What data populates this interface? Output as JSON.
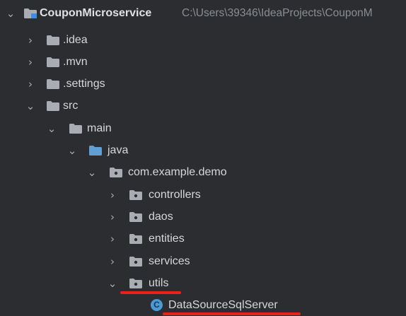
{
  "tree": {
    "root": {
      "name": "CouponMicroservice",
      "path": "C:\\Users\\39346\\IdeaProjects\\CouponM",
      "chevron": "chevron-down-icon",
      "icon": "module-folder-icon"
    },
    "items": [
      {
        "label": ".idea",
        "chevron": "chevron-right-icon",
        "icon": "folder-icon"
      },
      {
        "label": ".mvn",
        "chevron": "chevron-right-icon",
        "icon": "folder-icon"
      },
      {
        "label": ".settings",
        "chevron": "chevron-right-icon",
        "icon": "folder-icon"
      },
      {
        "label": "src",
        "chevron": "chevron-down-icon",
        "icon": "folder-icon"
      },
      {
        "label": "main",
        "chevron": "chevron-down-icon",
        "icon": "folder-icon"
      },
      {
        "label": "java",
        "chevron": "chevron-down-icon",
        "icon": "source-folder-icon"
      },
      {
        "label": "com.example.demo",
        "chevron": "chevron-down-icon",
        "icon": "package-icon"
      },
      {
        "label": "controllers",
        "chevron": "chevron-right-icon",
        "icon": "package-icon"
      },
      {
        "label": "daos",
        "chevron": "chevron-right-icon",
        "icon": "package-icon"
      },
      {
        "label": "entities",
        "chevron": "chevron-right-icon",
        "icon": "package-icon"
      },
      {
        "label": "services",
        "chevron": "chevron-right-icon",
        "icon": "package-icon"
      },
      {
        "label": "utils",
        "chevron": "chevron-down-icon",
        "icon": "package-icon"
      },
      {
        "label": "DataSourceSqlServer",
        "icon": "java-class-icon",
        "icon_letter": "C"
      }
    ]
  },
  "colors": {
    "background": "#2b2d30",
    "text": "#d5d7db",
    "path_text": "#8a8d92",
    "folder": "#a9adb3",
    "source_folder": "#5f9fd6",
    "module_accent": "#3d8ee0",
    "class_icon": "#4a9ad8",
    "annotation_underline": "#e8211c"
  }
}
